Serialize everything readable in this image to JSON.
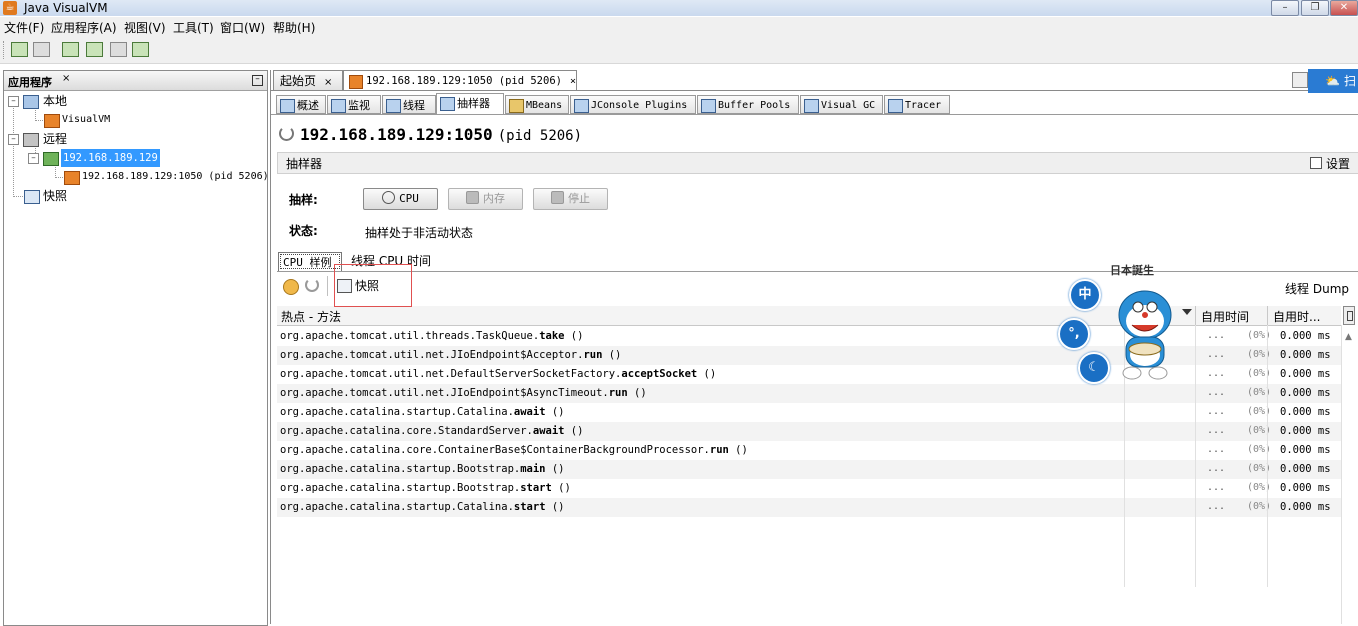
{
  "window": {
    "title": "Java VisualVM"
  },
  "menu": [
    "文件(F)",
    "应用程序(A)",
    "视图(V)",
    "工具(T)",
    "窗口(W)",
    "帮助(H)"
  ],
  "toolbar": {
    "buttons": [
      "open-icon",
      "save-icon",
      "add-jmx-icon",
      "add-remote-icon",
      "add-coredump-icon",
      "add-snapshot-icon"
    ]
  },
  "left_panel": {
    "title": "应用程序",
    "close_glyph": "×",
    "tree": {
      "local": "本地",
      "visualvm": "VisualVM",
      "remote": "远程",
      "host": "192.168.189.129",
      "process": "192.168.189.129:1050 (pid 5206)",
      "snapshots": "快照"
    }
  },
  "doc_tabs": [
    {
      "label": "起始页",
      "close": "×"
    },
    {
      "label": "192.168.189.129:1050 (pid 5206)",
      "close": "×"
    }
  ],
  "sub_tabs": [
    "概述",
    "监视",
    "线程",
    "抽样器",
    "MBeans",
    "JConsole Plugins",
    "Buffer Pools",
    "Visual GC",
    "Tracer"
  ],
  "connection": {
    "host": "192.168.189.129:1050",
    "pid": "(pid 5206)"
  },
  "sampler": {
    "section": "抽样器",
    "settings": "设置",
    "sample_label": "抽样:",
    "cpu_button": "CPU",
    "memory_button": "内存",
    "stop_button": "停止",
    "status_label": "状态:",
    "status_value": "抽样处于非活动状态"
  },
  "result_tabs": [
    "CPU 样例",
    "线程 CPU 时间"
  ],
  "result_toolbar": {
    "snapshot": "快照",
    "thread_dump": "线程 Dump"
  },
  "table": {
    "headers": {
      "method": "热点 - 方法",
      "self_time": "自用时间",
      "self_time_cpu": "自用时..."
    },
    "rows": [
      {
        "prefix": "org.apache.tomcat.util.threads.TaskQueue.",
        "method": "take",
        "suffix": " ()",
        "dots": "...",
        "pct": "(0%)",
        "time": "0.000 ms"
      },
      {
        "prefix": "org.apache.tomcat.util.net.JIoEndpoint$Acceptor.",
        "method": "run",
        "suffix": " ()",
        "dots": "...",
        "pct": "(0%)",
        "time": "0.000 ms"
      },
      {
        "prefix": "org.apache.tomcat.util.net.DefaultServerSocketFactory.",
        "method": "acceptSocket",
        "suffix": " ()",
        "dots": "...",
        "pct": "(0%)",
        "time": "0.000 ms"
      },
      {
        "prefix": "org.apache.tomcat.util.net.JIoEndpoint$AsyncTimeout.",
        "method": "run",
        "suffix": " ()",
        "dots": "...",
        "pct": "(0%)",
        "time": "0.000 ms"
      },
      {
        "prefix": "org.apache.catalina.startup.Catalina.",
        "method": "await",
        "suffix": " ()",
        "dots": "...",
        "pct": "(0%)",
        "time": "0.000 ms"
      },
      {
        "prefix": "org.apache.catalina.core.StandardServer.",
        "method": "await",
        "suffix": " ()",
        "dots": "...",
        "pct": "(0%)",
        "time": "0.000 ms"
      },
      {
        "prefix": "org.apache.catalina.core.ContainerBase$ContainerBackgroundProcessor.",
        "method": "run",
        "suffix": " ()",
        "dots": "...",
        "pct": "(0%)",
        "time": "0.000 ms"
      },
      {
        "prefix": "org.apache.catalina.startup.Bootstrap.",
        "method": "main",
        "suffix": " ()",
        "dots": "...",
        "pct": "(0%)",
        "time": "0.000 ms"
      },
      {
        "prefix": "org.apache.catalina.startup.Bootstrap.",
        "method": "start",
        "suffix": " ()",
        "dots": "...",
        "pct": "(0%)",
        "time": "0.000 ms"
      },
      {
        "prefix": "org.apache.catalina.startup.Catalina.",
        "method": "start",
        "suffix": " ()",
        "dots": "...",
        "pct": "(0%)",
        "time": "0.000 ms"
      }
    ]
  },
  "overlay": {
    "btn1": "中",
    "btn2": "°,",
    "btn3": "☾",
    "mascot_text": "日本誕生"
  },
  "colors": {
    "selection": "#3399ff",
    "accent": "#1a6fc4",
    "highlight_box": "#e05050"
  }
}
